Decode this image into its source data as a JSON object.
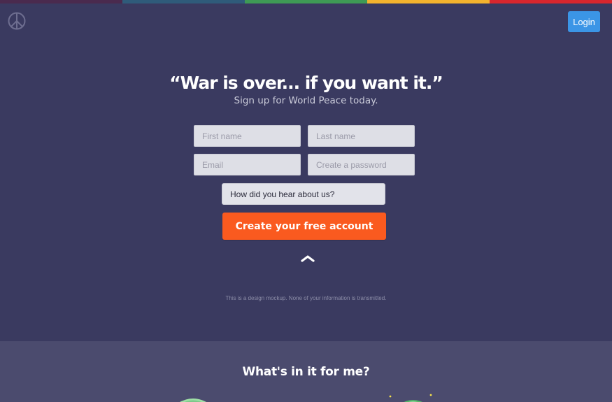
{
  "colors": {
    "hero_bg": "#3a3a60",
    "features_bg": "#4b4b6e",
    "login_bg": "#3b95e6",
    "cta_bg": "#fa5a1f",
    "rainbow": [
      "#4a2a4e",
      "#2f5b7a",
      "#3e9a55",
      "#f3b32e",
      "#d8262e"
    ]
  },
  "header": {
    "logo_icon": "peace-sign-icon",
    "login_label": "Login"
  },
  "hero": {
    "headline": "“War is over... if you want it.”",
    "subhead": "Sign up for World Peace today."
  },
  "form": {
    "first_name": {
      "placeholder": "First name",
      "value": ""
    },
    "last_name": {
      "placeholder": "Last name",
      "value": ""
    },
    "email": {
      "placeholder": "Email",
      "value": ""
    },
    "password": {
      "placeholder": "Create a password",
      "value": ""
    },
    "referral": {
      "selected": "How did you hear about us?"
    },
    "submit_label": "Create your free account",
    "caret_icon": "chevron-up-icon"
  },
  "disclaimer": "This is a design mockup. None of your information is transmitted.",
  "features": {
    "title": "What's in it for me?",
    "icons": [
      "globe-icon",
      "globe-sparkle-icon"
    ]
  }
}
